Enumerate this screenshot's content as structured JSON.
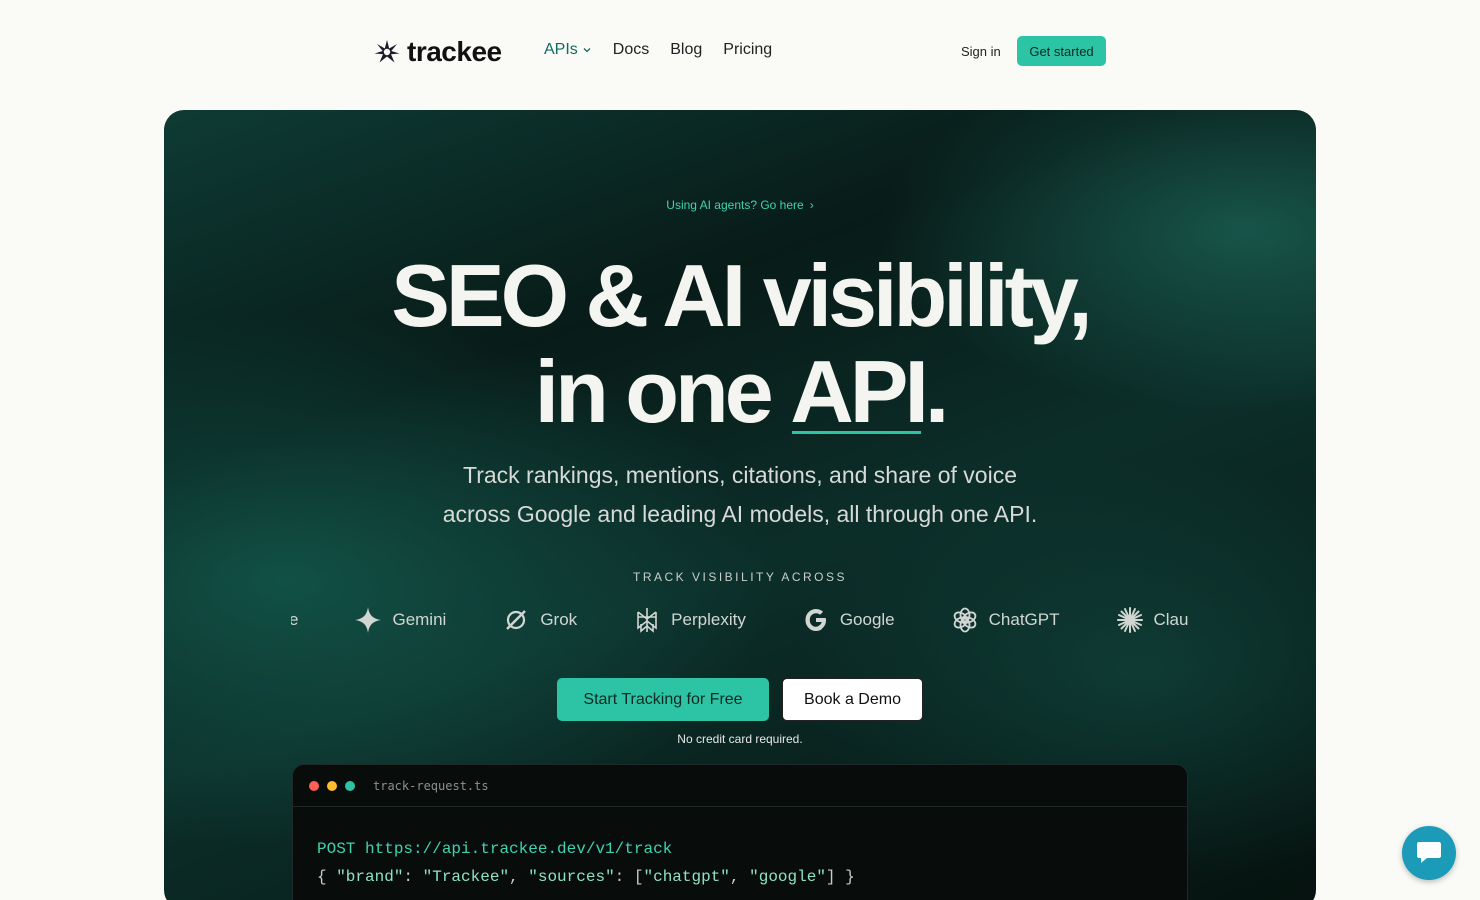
{
  "nav": {
    "logo_text": "trackee",
    "links": [
      {
        "label": "APIs",
        "has_dropdown": true
      },
      {
        "label": "Docs"
      },
      {
        "label": "Blog"
      },
      {
        "label": "Pricing"
      }
    ],
    "sign_in": "Sign in",
    "get_started": "Get started"
  },
  "hero": {
    "agents_link": "Using AI agents? Go here",
    "headline_line1": "SEO & AI visibility,",
    "headline_line2_prefix": "in one ",
    "headline_line2_api": "API",
    "headline_line2_suffix": ".",
    "subtitle_line1": "Track rankings, mentions, citations, and share of voice",
    "subtitle_line2": "across Google and leading AI models, all through one API.",
    "track_label": "TRACK VISIBILITY ACROSS",
    "brands": [
      "e",
      "Gemini",
      "Grok",
      "Perplexity",
      "Google",
      "ChatGPT",
      "Clau"
    ],
    "cta_primary": "Start Tracking for Free",
    "cta_secondary": "Book a Demo",
    "no_card": "No credit card required."
  },
  "code": {
    "filename": "track-request.ts",
    "method": "POST",
    "url": "https://api.trackee.dev/v1/track",
    "body_open": "{ ",
    "key1": "\"brand\"",
    "val1": "\"Trackee\"",
    "key2": "\"sources\"",
    "arr_open": "[",
    "src1": "\"chatgpt\"",
    "src2": "\"google\"",
    "arr_close": "]",
    "body_close": " }",
    "colon": ": ",
    "comma": ", "
  },
  "colors": {
    "accent": "#2cc4a4",
    "hero_dark": "#081b18",
    "chat": "#1b9bb8",
    "dot_red": "#ff5f57",
    "dot_yellow": "#febc2e",
    "dot_green": "#2cc4a4"
  },
  "icons": {
    "logo": "asterisk-star-icon",
    "chat": "chat-bubble-icon"
  }
}
